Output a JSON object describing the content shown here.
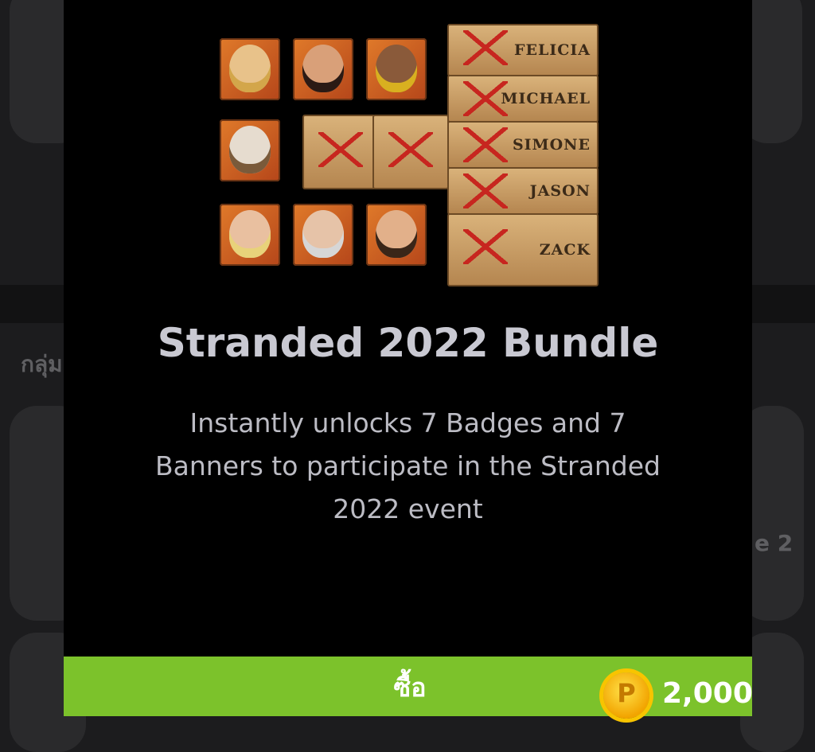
{
  "background": {
    "group_label": "กลุ่ม",
    "side_text": "e 2"
  },
  "bundle": {
    "title": "Stranded 2022 Bundle",
    "description": "Instantly unlocks 7 Badges and 7 Banners to participate in the Stranded 2022 event",
    "banner_names": [
      "FELICIA",
      "MICHAEL",
      "SIMONE",
      "JASON",
      "ZACK"
    ]
  },
  "buy": {
    "label": "ซื้อ",
    "coin_symbol": "P",
    "price": "2,000",
    "bar_color": "#7cc22b"
  }
}
